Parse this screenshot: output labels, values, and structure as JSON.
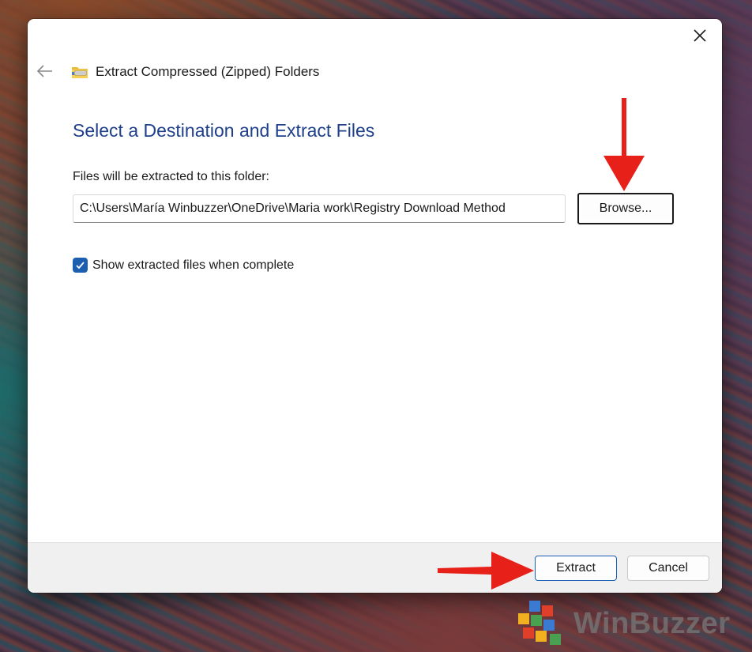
{
  "dialog": {
    "title": "Extract Compressed (Zipped) Folders",
    "heading": "Select a Destination and Extract Files",
    "path_label": "Files will be extracted to this folder:",
    "path_value": "C:\\Users\\María Winbuzzer\\OneDrive\\Maria work\\Registry Download Method",
    "browse_label": "Browse...",
    "checkbox_label": "Show extracted files when complete",
    "checkbox_checked": true,
    "extract_label": "Extract",
    "cancel_label": "Cancel"
  },
  "icons": {
    "back": "back-arrow-icon",
    "close": "close-icon",
    "title": "zip-folder-icon",
    "check": "checkmark-icon"
  },
  "colors": {
    "heading": "#1e3f8a",
    "accent": "#1c5fb0",
    "annotation_arrow": "#e8201a"
  },
  "watermark": {
    "text": "WinBuzzer"
  }
}
